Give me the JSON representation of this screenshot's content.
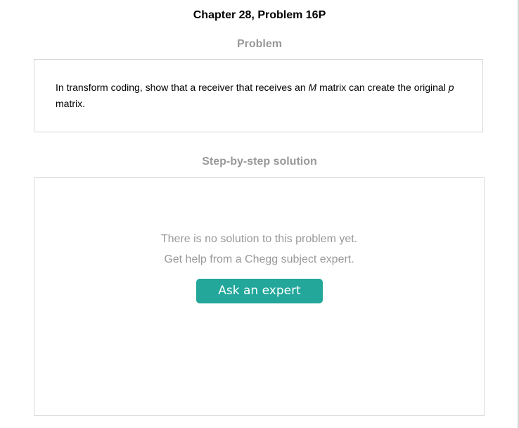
{
  "header": {
    "chapter_title": "Chapter 28, Problem 16P"
  },
  "problem": {
    "heading": "Problem",
    "text_before_m": "In transform coding, show that a receiver that receives an ",
    "var_m": "M",
    "text_between": " matrix can create the original ",
    "var_p": "p",
    "text_after_p": "matrix."
  },
  "solution": {
    "heading": "Step-by-step solution",
    "no_solution_line_1": "There is no solution to this problem yet.",
    "no_solution_line_2": "Get help from a Chegg subject expert.",
    "ask_button_label": "Ask an expert"
  },
  "colors": {
    "accent": "#22a79a",
    "muted_text": "#999999",
    "border": "#d9d9d9"
  }
}
